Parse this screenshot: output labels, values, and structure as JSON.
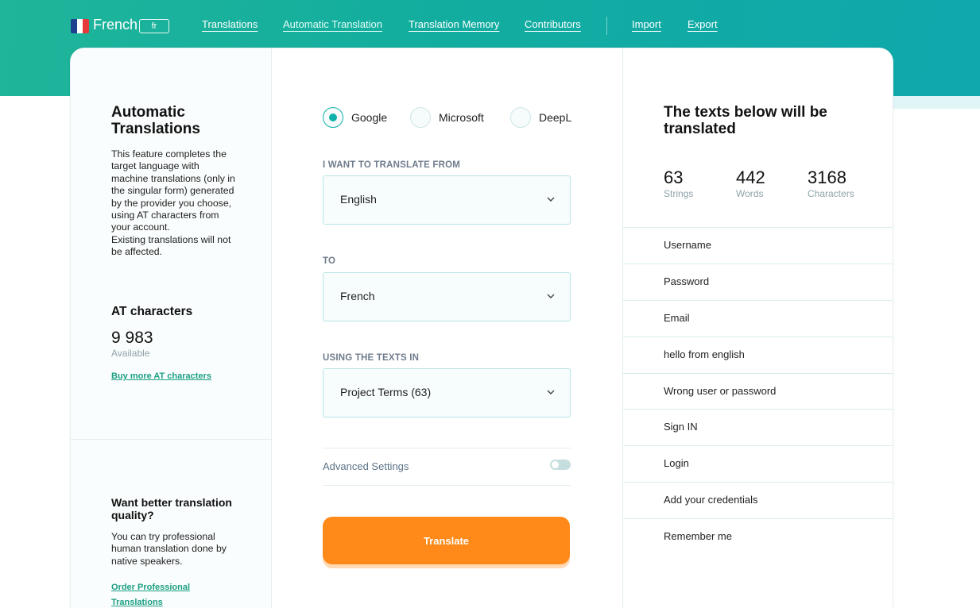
{
  "header": {
    "language": "French",
    "language_code": "fr",
    "flag_colors": [
      "#1f3f8f",
      "#ffffff",
      "#e63a3a"
    ],
    "nav": [
      {
        "label": "Translations",
        "active": false
      },
      {
        "label": "Automatic Translation",
        "active": true
      },
      {
        "label": "Translation Memory",
        "active": false
      },
      {
        "label": "Contributors",
        "active": false
      },
      {
        "label": "Import",
        "active": false
      },
      {
        "label": "Export",
        "active": false
      }
    ]
  },
  "left": {
    "title": "Automatic Translations",
    "description": "This feature completes the target language with machine translations (only in the singular form) generated by the provider you choose, using AT characters from your account.\nExisting translations will not be affected.",
    "at_title": "AT characters",
    "at_count": "9 983",
    "at_available": "Available",
    "buy_link": "Buy more AT characters",
    "better_title": "Want better translation quality?",
    "better_desc": "You can try professional human translation done by native speakers.",
    "order_link": "Order Professional Translations"
  },
  "middle": {
    "providers": [
      {
        "label": "Google",
        "checked": true
      },
      {
        "label": "Microsoft",
        "checked": false
      },
      {
        "label": "DeepL",
        "checked": false
      }
    ],
    "from_label": "I WANT TO TRANSLATE FROM",
    "from_value": "English",
    "to_label": "TO",
    "to_value": "French",
    "using_label": "USING THE TEXTS IN",
    "using_value": "Project Terms (63)",
    "advanced_label": "Advanced Settings",
    "advanced_enabled": false,
    "translate_button": "Translate",
    "accent_color": "#0fb2aa",
    "button_color": "#ff8a1a"
  },
  "right": {
    "title": "The texts below will be translated",
    "stats": [
      {
        "value": "63",
        "label": "Strings"
      },
      {
        "value": "442",
        "label": "Words"
      },
      {
        "value": "3168",
        "label": "Characters"
      }
    ],
    "texts": [
      "Username",
      "Password",
      "Email",
      "hello from english",
      "Wrong user or password",
      "Sign IN",
      "Login",
      "Add your credentials",
      "Remember me"
    ]
  }
}
